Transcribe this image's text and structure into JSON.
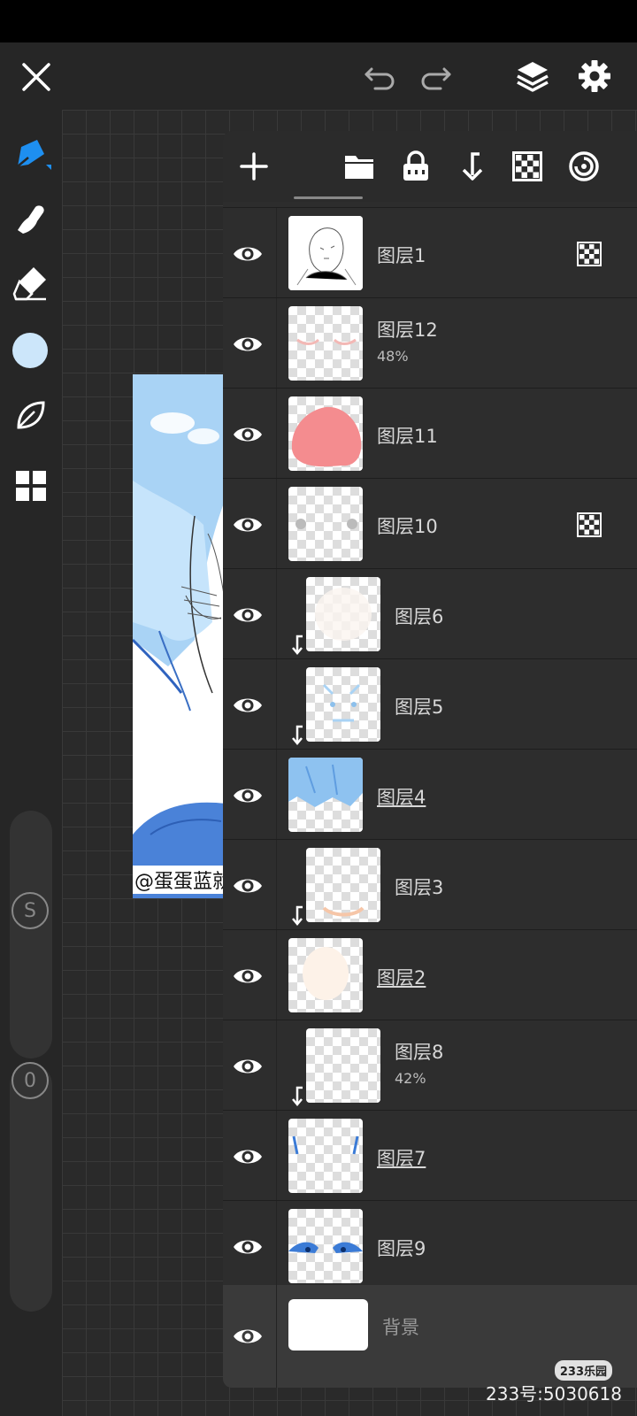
{
  "layers_panel": {
    "layers": [
      {
        "name": "图层1",
        "opacity": "",
        "clipped": false,
        "underlined": false,
        "alpha_lock": true
      },
      {
        "name": "图层12",
        "opacity": "48%",
        "clipped": false,
        "underlined": false,
        "alpha_lock": false
      },
      {
        "name": "图层11",
        "opacity": "",
        "clipped": false,
        "underlined": false,
        "alpha_lock": false
      },
      {
        "name": "图层10",
        "opacity": "",
        "clipped": false,
        "underlined": false,
        "alpha_lock": true
      },
      {
        "name": "图层6",
        "opacity": "",
        "clipped": true,
        "underlined": false,
        "alpha_lock": false
      },
      {
        "name": "图层5",
        "opacity": "",
        "clipped": true,
        "underlined": false,
        "alpha_lock": false
      },
      {
        "name": "图层4",
        "opacity": "",
        "clipped": false,
        "underlined": true,
        "alpha_lock": false
      },
      {
        "name": "图层3",
        "opacity": "",
        "clipped": true,
        "underlined": false,
        "alpha_lock": false
      },
      {
        "name": "图层2",
        "opacity": "",
        "clipped": false,
        "underlined": true,
        "alpha_lock": false
      },
      {
        "name": "图层8",
        "opacity": "42%",
        "clipped": true,
        "underlined": false,
        "alpha_lock": false
      },
      {
        "name": "图层7",
        "opacity": "",
        "clipped": false,
        "underlined": true,
        "alpha_lock": false
      },
      {
        "name": "图层9",
        "opacity": "",
        "clipped": false,
        "underlined": false,
        "alpha_lock": false
      }
    ],
    "background_layer": {
      "name": "背景"
    }
  },
  "sliders": {
    "size_knob_label": "S",
    "opacity_knob_label": "0"
  },
  "canvas": {
    "caption": "@蛋蛋蓝就是苦苦的"
  },
  "colors": {
    "accent": "#1e8ff0",
    "current_color": "#cce6fa",
    "panel_bg": "#2d2d2d"
  },
  "overlay": {
    "watermark_logo": "233乐园",
    "source_id": "233号:5030618"
  }
}
